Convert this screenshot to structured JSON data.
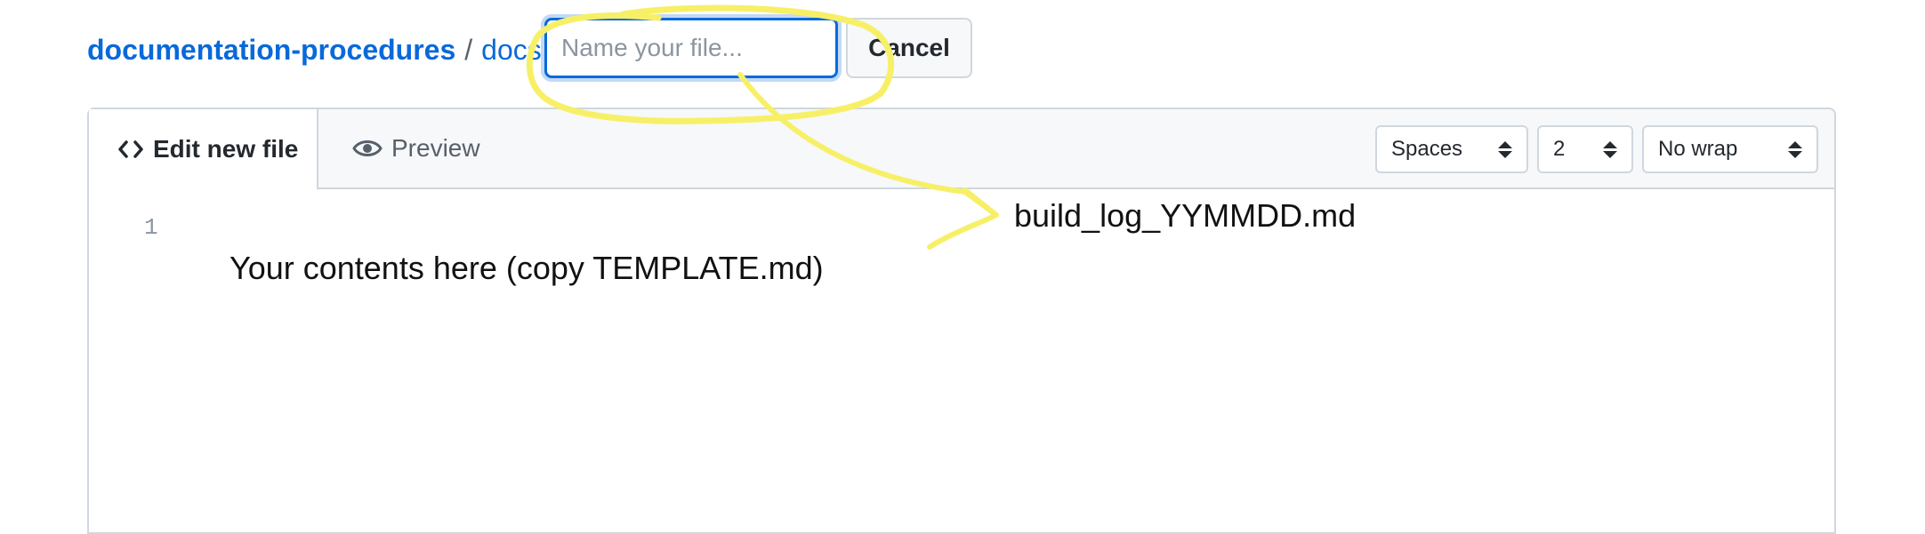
{
  "breadcrumb": {
    "repo": "documentation-procedures",
    "separator": "/",
    "folder": "docs"
  },
  "filename_input": {
    "placeholder": "Name your file...",
    "value": ""
  },
  "cancel_label": "Cancel",
  "tabs": [
    {
      "label": "Edit new file",
      "icon": "code-icon",
      "active": true
    },
    {
      "label": "Preview",
      "icon": "eye-icon",
      "active": false
    }
  ],
  "editor_options": {
    "indent_mode": "Spaces",
    "indent_size": "2",
    "wrap_mode": "No wrap"
  },
  "editor": {
    "line_number": "1",
    "content": "Your contents here (copy TEMPLATE.md)"
  },
  "annotation": {
    "label": "build_log_YYMMDD.md",
    "highlight_color": "#f7f067"
  },
  "colors": {
    "link": "#0969da",
    "focus_border": "#0969da",
    "header_bg": "#f6f8fa",
    "border": "#d0d7de"
  }
}
